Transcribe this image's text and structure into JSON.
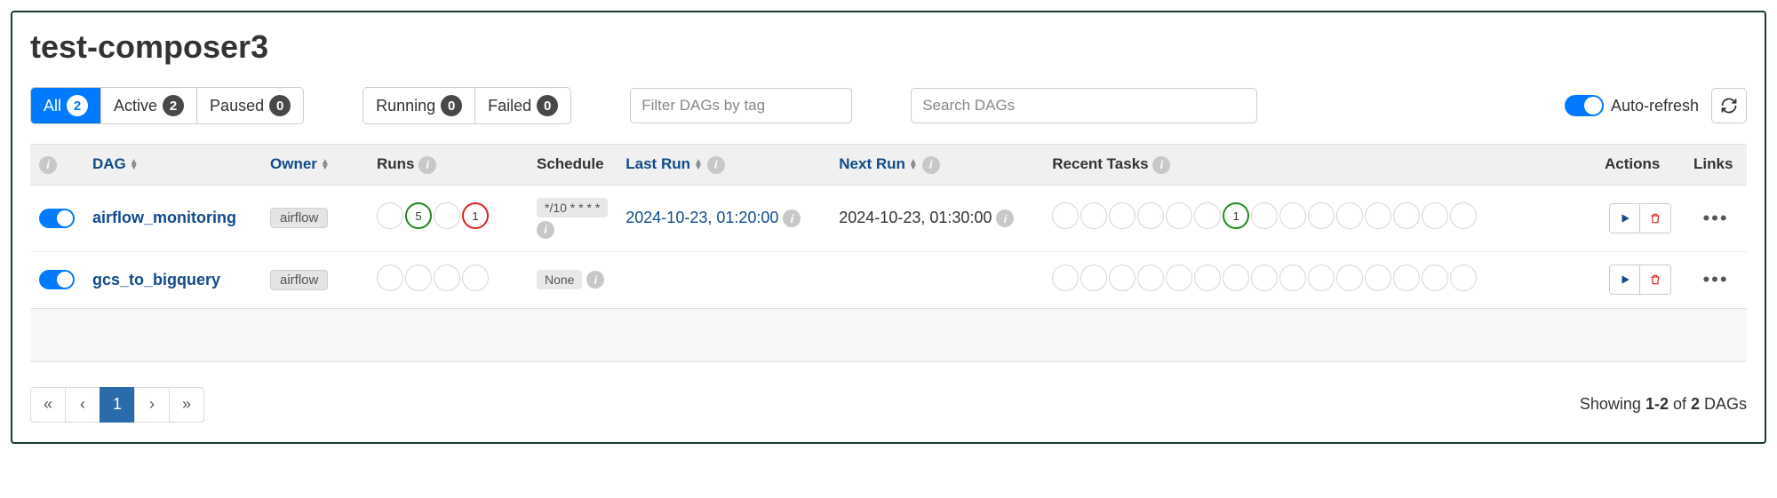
{
  "title": "test-composer3",
  "filter_tabs": [
    {
      "label": "All",
      "count": 2,
      "active": true
    },
    {
      "label": "Active",
      "count": 2,
      "active": false
    },
    {
      "label": "Paused",
      "count": 0,
      "active": false
    }
  ],
  "status_tabs": [
    {
      "label": "Running",
      "count": 0
    },
    {
      "label": "Failed",
      "count": 0
    }
  ],
  "filter_placeholder": "Filter DAGs by tag",
  "search_placeholder": "Search DAGs",
  "autorefresh_label": "Auto-refresh",
  "columns": {
    "dag": "DAG",
    "owner": "Owner",
    "runs": "Runs",
    "schedule": "Schedule",
    "last_run": "Last Run",
    "next_run": "Next Run",
    "recent_tasks": "Recent Tasks",
    "actions": "Actions",
    "links": "Links"
  },
  "dags": [
    {
      "enabled": true,
      "name": "airflow_monitoring",
      "owner": "airflow",
      "runs": [
        {
          "count": null,
          "state": "none"
        },
        {
          "count": 5,
          "state": "success"
        },
        {
          "count": null,
          "state": "none"
        },
        {
          "count": 1,
          "state": "failed"
        }
      ],
      "schedule": "*/10 * * * *",
      "last_run": "2024-10-23, 01:20:00",
      "next_run": "2024-10-23, 01:30:00",
      "recent_tasks": [
        null,
        null,
        null,
        null,
        null,
        null,
        1,
        null,
        null,
        null,
        null,
        null,
        null,
        null,
        null
      ]
    },
    {
      "enabled": true,
      "name": "gcs_to_bigquery",
      "owner": "airflow",
      "runs": [
        {
          "count": null,
          "state": "none"
        },
        {
          "count": null,
          "state": "none"
        },
        {
          "count": null,
          "state": "none"
        },
        {
          "count": null,
          "state": "none"
        }
      ],
      "schedule": "None",
      "last_run": "",
      "next_run": "",
      "recent_tasks": [
        null,
        null,
        null,
        null,
        null,
        null,
        null,
        null,
        null,
        null,
        null,
        null,
        null,
        null,
        null
      ]
    }
  ],
  "pager": {
    "first": "«",
    "prev": "‹",
    "pages": [
      "1"
    ],
    "current": "1",
    "next": "›",
    "last": "»"
  },
  "showing_html": "Showing <b>1-2</b> of <b>2</b> DAGs"
}
